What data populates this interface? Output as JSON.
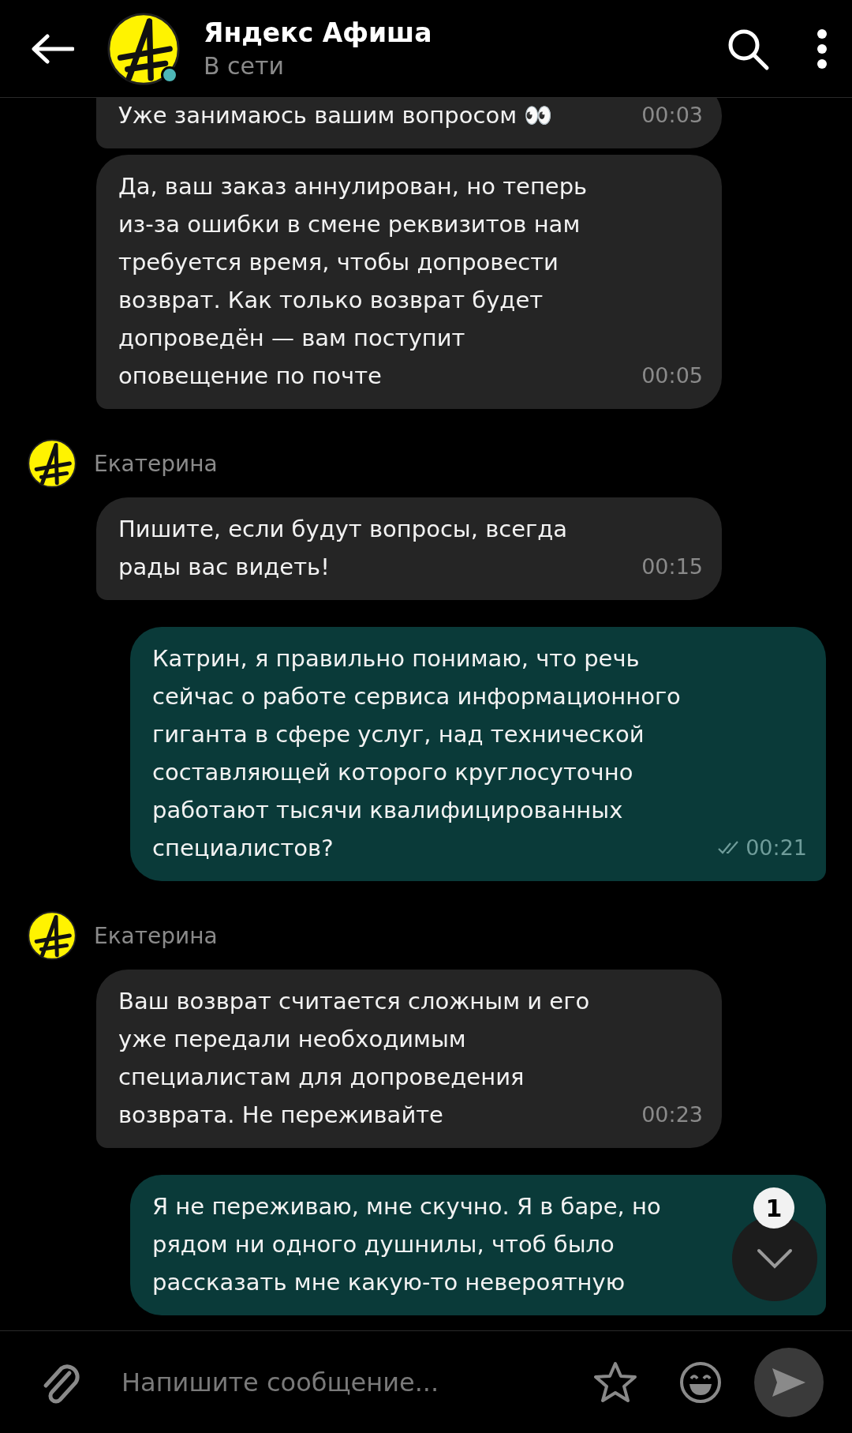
{
  "header": {
    "title": "Яндекс Афиша",
    "status": "В сети",
    "online": true
  },
  "messages": [
    {
      "kind": "incoming",
      "lines": [
        "Уже занимаюсь вашим вопросом 👀"
      ],
      "time": "00:03"
    },
    {
      "kind": "incoming",
      "lines": [
        "Да, ваш заказ аннулирован, но теперь",
        "из-за ошибки в смене реквизитов нам",
        "требуется время, чтобы допровести",
        "возврат. Как только возврат будет",
        "допроведён — вам поступит",
        "оповещение по почте"
      ],
      "time": "00:05"
    },
    {
      "kind": "sender",
      "name": "Екатерина"
    },
    {
      "kind": "incoming",
      "lines": [
        "Пишите, если будут вопросы, всегда",
        "рады вас видеть!"
      ],
      "time": "00:15"
    },
    {
      "kind": "outgoing",
      "lines": [
        "Катрин, я правильно понимаю, что речь",
        "сейчас о работе сервиса информационного",
        "гиганта в сфере услуг, над технической",
        "составляющей которого круглосуточно",
        "работают тысячи квалифицированных",
        "специалистов?"
      ],
      "time": "00:21",
      "read": true
    },
    {
      "kind": "sender",
      "name": "Екатерина"
    },
    {
      "kind": "incoming",
      "lines": [
        "Ваш возврат считается сложным и его",
        "уже передали необходимым",
        "специалистам для допроведения",
        "возврата. Не переживайте"
      ],
      "time": "00:23"
    },
    {
      "kind": "outgoing",
      "lines": [
        "Я не переживаю, мне скучно. Я в баре, но",
        "рядом ни одного душнилы, чтоб было",
        "рассказать мне какую-то невероятную"
      ]
    }
  ],
  "scroll_button": {
    "badge": "1"
  },
  "composer": {
    "placeholder": "Напишите сообщение..."
  }
}
